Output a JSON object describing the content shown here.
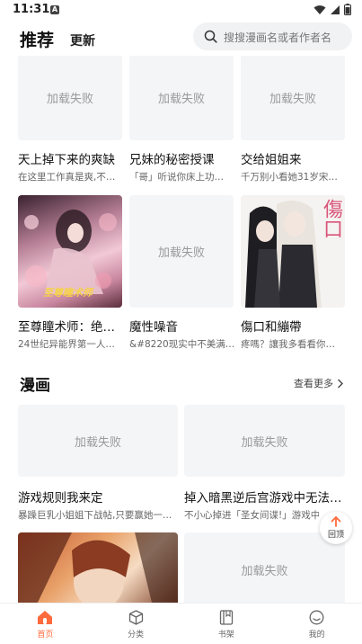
{
  "status": {
    "time": "11:31",
    "notif_badge": "A"
  },
  "header": {
    "tab_recommend": "推荐",
    "tab_update": "更新",
    "search_placeholder": "搜搜漫画名或者作者名"
  },
  "load_failed_text": "加载失败",
  "row1": [
    {
      "title": "天上掉下来的爽缺",
      "desc": "在这里工作真是爽,不…",
      "cover": "failed"
    },
    {
      "title": "兄妹的秘密授课",
      "desc": "「哥」听说你床上功…",
      "cover": "failed"
    },
    {
      "title": "交给姐姐来",
      "desc": "千万别小看她31岁宋…",
      "cover": "failed"
    }
  ],
  "row2": [
    {
      "title": "至尊瞳术师：绝…",
      "desc": "24世纪异能界第一人…",
      "cover": "image",
      "cover_text": "至尊瞳术师"
    },
    {
      "title": "魔性噪音",
      "desc": "&#8220现实中不美满…",
      "cover": "failed"
    },
    {
      "title": "傷口和繃帶",
      "desc": "疼嗎？讓我多看看你…",
      "cover": "image",
      "cover_text": "傷口"
    }
  ],
  "manga_section": {
    "title": "漫画",
    "more": "查看更多"
  },
  "row3": [
    {
      "title": "游戏规则我来定",
      "desc": "暴躁巨乳小姐姐下战帖,只要赢她一…",
      "cover": "failed"
    },
    {
      "title": "掉入暗黑逆后宫游戏中无法…",
      "desc": "不小心掉进「圣女间谍!」游戏中…",
      "cover": "failed"
    }
  ],
  "row4": [
    {
      "cover": "image"
    },
    {
      "cover": "failed"
    }
  ],
  "back_to_top": "回顶",
  "bottom_nav": [
    {
      "label": "首页",
      "active": true
    },
    {
      "label": "分类",
      "active": false
    },
    {
      "label": "书架",
      "active": false
    },
    {
      "label": "我的",
      "active": false
    }
  ],
  "colors": {
    "accent": "#ff6a3d",
    "placeholder_bg": "#f4f5f7"
  }
}
